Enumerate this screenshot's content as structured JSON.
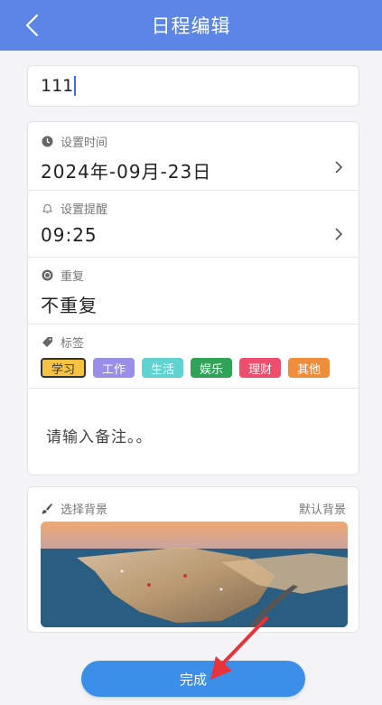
{
  "header": {
    "title": "日程编辑",
    "back_icon": "chevron-left-icon"
  },
  "title_input": {
    "value": "111"
  },
  "time": {
    "label": "设置时间",
    "value": "2024年-09月-23日",
    "icon": "clock-icon"
  },
  "reminder": {
    "label": "设置提醒",
    "value": "09:25",
    "icon": "bell-icon"
  },
  "repeat": {
    "label": "重复",
    "value": "不重复",
    "icon": "repeat-icon"
  },
  "tags": {
    "label": "标签",
    "icon": "tag-icon",
    "items": [
      {
        "label": "学习",
        "color": "#f5c242",
        "selected": true
      },
      {
        "label": "工作",
        "color": "#9a8fe8",
        "selected": false
      },
      {
        "label": "生活",
        "color": "#5fd3d0",
        "selected": false
      },
      {
        "label": "娱乐",
        "color": "#2fa456",
        "selected": false
      },
      {
        "label": "理财",
        "color": "#ee4d6b",
        "selected": false
      },
      {
        "label": "其他",
        "color": "#f08d3a",
        "selected": false
      }
    ]
  },
  "note": {
    "placeholder": "请输入备注。。"
  },
  "background": {
    "label": "选择背景",
    "default_label": "默认背景",
    "icon": "brush-icon"
  },
  "done_button": {
    "label": "完成"
  },
  "colors": {
    "header": "#5b86e5",
    "done_button": "#3b8fe8",
    "arrow": "#e8323c"
  }
}
